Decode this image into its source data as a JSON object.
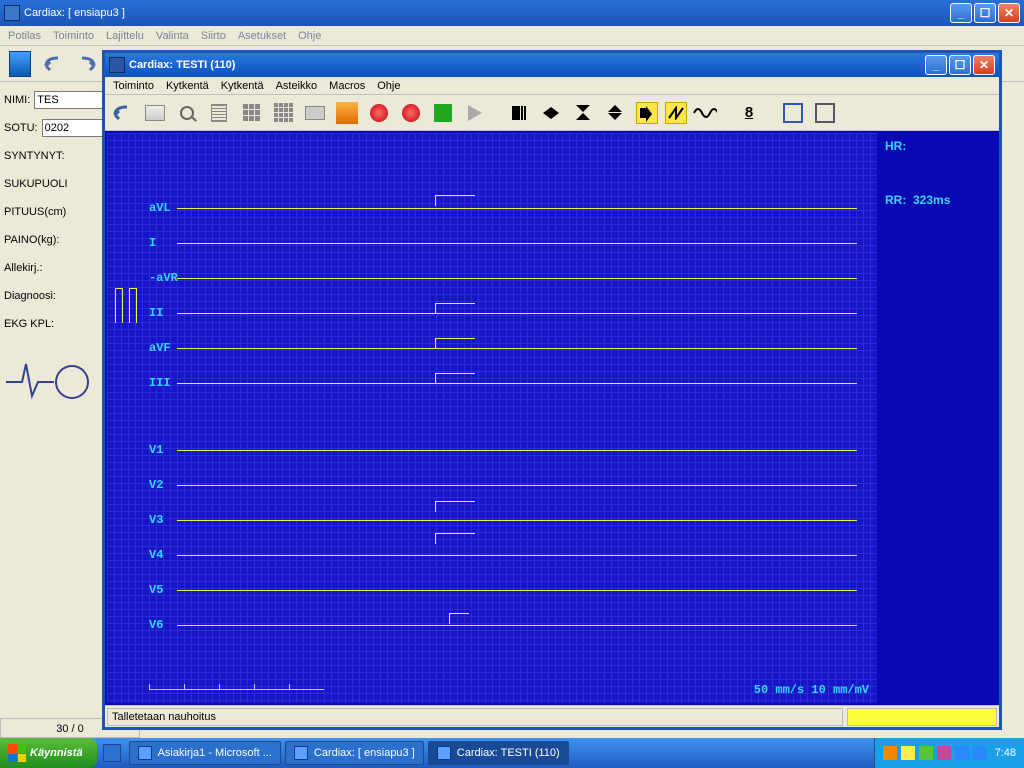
{
  "outer": {
    "title": "Cardiax: [ ensiapu3 ]",
    "menu": [
      "Potilas",
      "Toiminto",
      "Lajittelu",
      "Valinta",
      "Siirto",
      "Asetukset",
      "Ohje"
    ],
    "form": {
      "name_label": "NIMI:",
      "name_value": "TES",
      "ssn_label": "SOTU:",
      "ssn_value": "0202",
      "born_label": "SYNTYNYT:",
      "sex_label": "SUKUPUOLI",
      "height_label": "PITUUS(cm)",
      "weight_label": "PAINO(kg):",
      "sign_label": "Allekirj.:",
      "diag_label": "Diagnoosi:",
      "ekg_label": "EKG KPL:"
    },
    "status": "30 / 0"
  },
  "inner": {
    "title": "Cardiax: TESTI (110)",
    "menu": [
      "Toiminto",
      "Kytkentä",
      "Kytkentä",
      "Asteikko",
      "Macros",
      "Ohje"
    ],
    "eight": "8",
    "leads": [
      "aVL",
      "I",
      "-aVR",
      "II",
      "aVF",
      "III",
      "V1",
      "V2",
      "V3",
      "V4",
      "V5",
      "V6"
    ],
    "readout": {
      "hr_label": "HR:",
      "hr_value": "",
      "rr_label": "RR:",
      "rr_value": "323ms"
    },
    "scale": "50 mm/s  10 mm/mV",
    "status": "Talletetaan nauhoitus"
  },
  "taskbar": {
    "start": "Käynnistä",
    "tasks": [
      {
        "label": "Asiakirja1 - Microsoft ...",
        "active": false
      },
      {
        "label": "Cardiax: [ ensiapu3 ]",
        "active": false
      },
      {
        "label": "Cardiax: TESTI (110)",
        "active": true
      }
    ],
    "clock": "7:48"
  }
}
